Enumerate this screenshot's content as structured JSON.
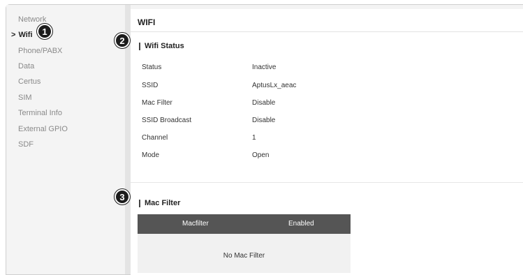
{
  "sidebar": {
    "items": [
      {
        "label": "Network"
      },
      {
        "label": "Wifi",
        "chevron": ">"
      },
      {
        "label": "Phone/PABX"
      },
      {
        "label": "Data"
      },
      {
        "label": "Certus"
      },
      {
        "label": "SIM"
      },
      {
        "label": "Terminal Info"
      },
      {
        "label": "External GPIO"
      },
      {
        "label": "SDF"
      }
    ],
    "active_index": 1
  },
  "main": {
    "title": "WIFI",
    "wifi_status": {
      "heading": "Wifi Status",
      "rows": [
        {
          "label": "Status",
          "value": "Inactive"
        },
        {
          "label": "SSID",
          "value": "AptusLx_aeac"
        },
        {
          "label": "Mac Filter",
          "value": "Disable"
        },
        {
          "label": "SSID Broadcast",
          "value": "Disable"
        },
        {
          "label": "Channel",
          "value": "1"
        },
        {
          "label": "Mode",
          "value": "Open"
        }
      ]
    },
    "mac_filter": {
      "heading": "Mac Filter",
      "columns": [
        "Macfilter",
        "Enabled"
      ],
      "empty_text": "No Mac Filter"
    }
  },
  "callouts": [
    "1",
    "2",
    "3"
  ],
  "colors": {
    "table_header": "#555555",
    "badge": "#1c1c1c",
    "sidebar_bg": "#f4f4f4"
  }
}
